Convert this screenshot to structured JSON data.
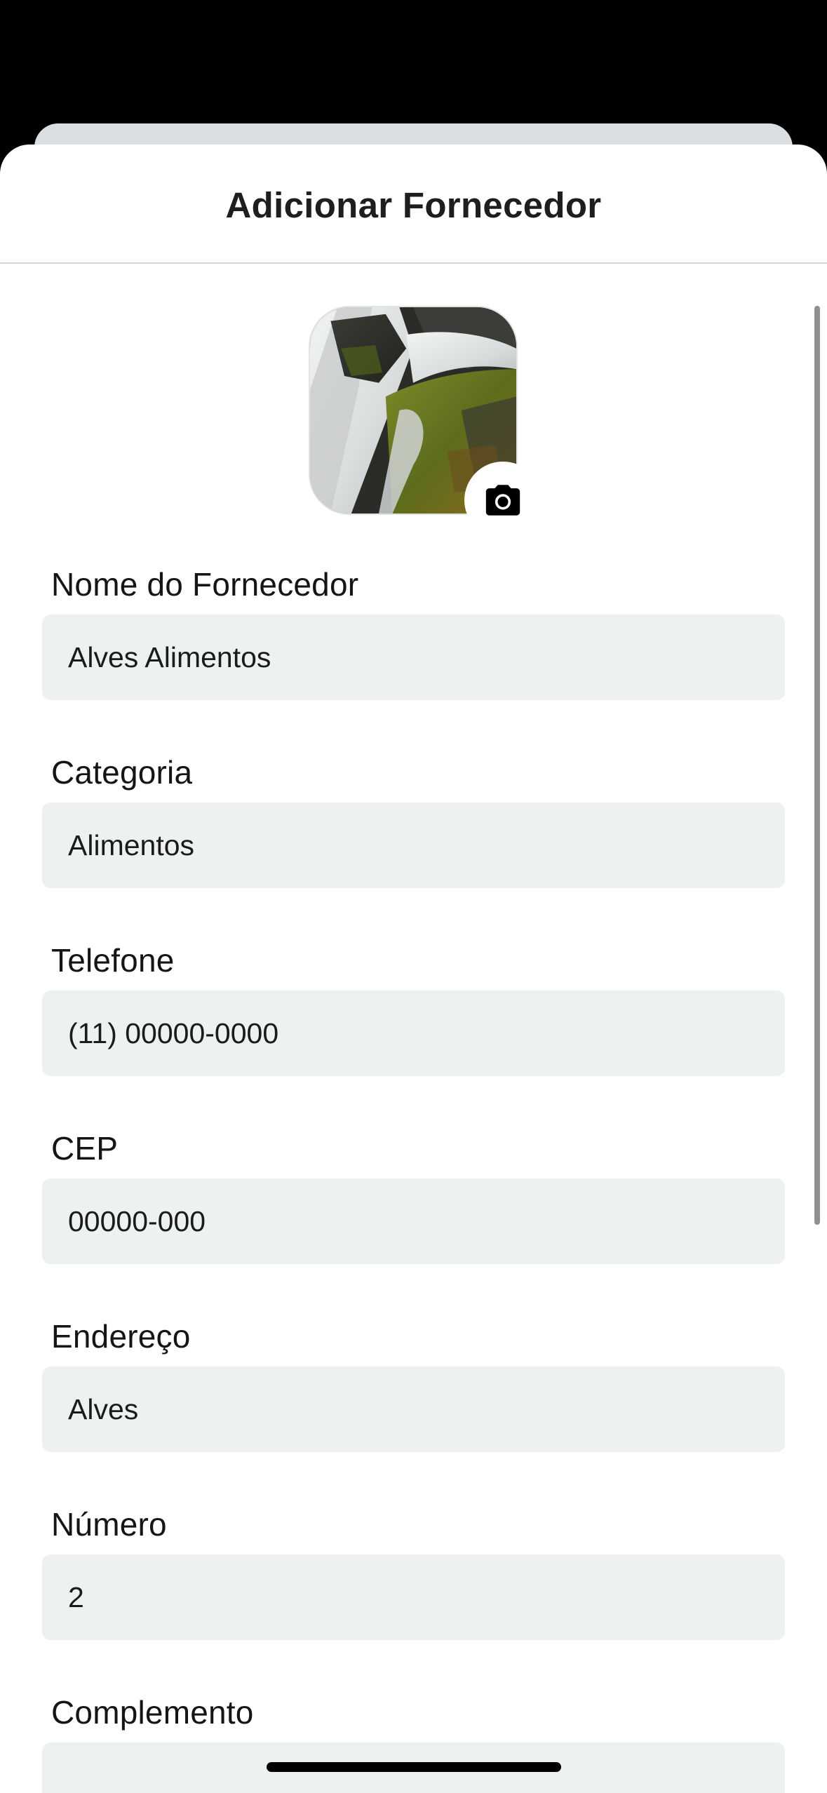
{
  "sheet": {
    "title": "Adicionar Fornecedor"
  },
  "photo": {
    "subject": "waterfall-photo",
    "camera_icon": "camera-icon"
  },
  "form": {
    "fields": [
      {
        "label": "Nome do Fornecedor",
        "value": "Alves Alimentos"
      },
      {
        "label": "Categoria",
        "value": "Alimentos"
      },
      {
        "label": "Telefone",
        "value": "(11) 00000-0000"
      },
      {
        "label": "CEP",
        "value": "00000-000"
      },
      {
        "label": "Endereço",
        "value": "Alves"
      },
      {
        "label": "Número",
        "value": "2"
      },
      {
        "label": "Complemento",
        "value": ""
      }
    ]
  },
  "colors": {
    "input_background": "#eef1f2",
    "sheet_background": "#ffffff",
    "backdrop": "#000000"
  }
}
